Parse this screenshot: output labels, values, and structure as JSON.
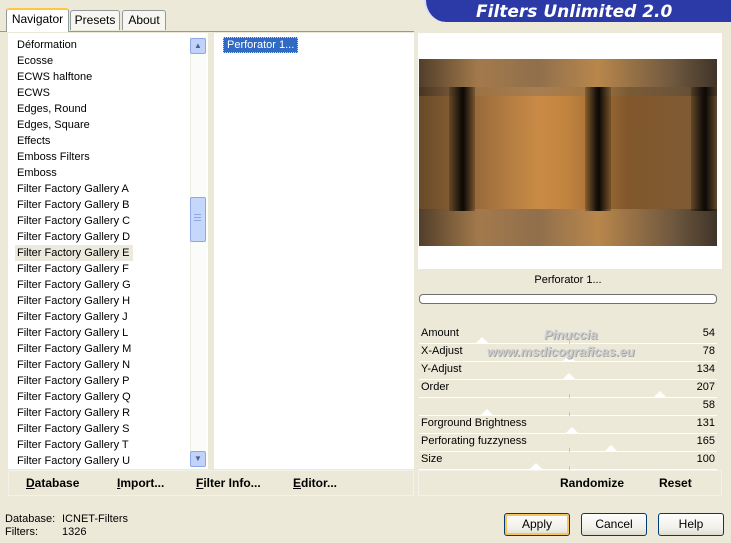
{
  "tabs": [
    {
      "label": "Navigator",
      "active": true
    },
    {
      "label": "Presets",
      "active": false
    },
    {
      "label": "About",
      "active": false
    }
  ],
  "title": "Filters Unlimited 2.0",
  "categories": [
    "Déformation",
    "Ecosse",
    "ECWS halftone",
    "ECWS",
    "Edges, Round",
    "Edges, Square",
    "Effects",
    "Emboss Filters",
    "Emboss",
    "Filter Factory Gallery A",
    "Filter Factory Gallery B",
    "Filter Factory Gallery C",
    "Filter Factory Gallery D",
    "Filter Factory Gallery E",
    "Filter Factory Gallery F",
    "Filter Factory Gallery G",
    "Filter Factory Gallery H",
    "Filter Factory Gallery J",
    "Filter Factory Gallery L",
    "Filter Factory Gallery M",
    "Filter Factory Gallery N",
    "Filter Factory Gallery P",
    "Filter Factory Gallery Q",
    "Filter Factory Gallery R",
    "Filter Factory Gallery S",
    "Filter Factory Gallery T",
    "Filter Factory Gallery U"
  ],
  "selected_category": "Filter Factory Gallery E",
  "filters": [
    "Perforator 1..."
  ],
  "selected_filter": "Perforator 1...",
  "filter_title": "Perforator 1...",
  "params": [
    {
      "name": "Amount",
      "value": "54"
    },
    {
      "name": "X-Adjust",
      "value": "78"
    },
    {
      "name": "Y-Adjust",
      "value": "134"
    },
    {
      "name": "Order",
      "value": "207"
    },
    {
      "name": "",
      "value": "58"
    },
    {
      "name": "Forground Brightness",
      "value": "131"
    },
    {
      "name": "Perforating fuzzyness",
      "value": "165"
    },
    {
      "name": "Size",
      "value": "100"
    }
  ],
  "watermark": {
    "line1": "Pinuccia",
    "line2": "www.msdicograficas.eu"
  },
  "left_actions": [
    {
      "label": "Database",
      "underline": "D",
      "rest": "atabase"
    },
    {
      "label": "Import...",
      "underline": "I",
      "rest": "mport..."
    },
    {
      "label": "Filter Info...",
      "underline": "F",
      "rest": "ilter Info..."
    },
    {
      "label": "Editor...",
      "underline": "E",
      "rest": "ditor..."
    }
  ],
  "right_actions": {
    "randomize": "Randomize",
    "reset": "Reset"
  },
  "info": {
    "database_label": "Database:",
    "database_value": "ICNET-Filters",
    "filters_label": "Filters:",
    "filters_value": "1326"
  },
  "buttons": {
    "apply": "Apply",
    "cancel": "Cancel",
    "help": "Help"
  }
}
